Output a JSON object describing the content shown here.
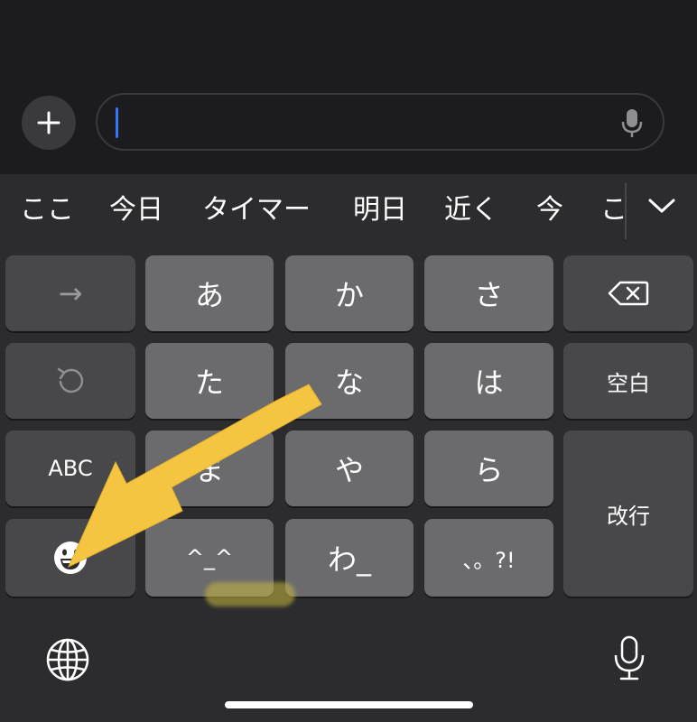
{
  "suggestions": [
    "ここ",
    "今日",
    "タイマー",
    "明日",
    "近く",
    "今",
    "こ"
  ],
  "keys": {
    "arrow_right": "→",
    "a": "あ",
    "ka": "か",
    "sa": "さ",
    "ta": "た",
    "na": "な",
    "ha": "は",
    "space": "空白",
    "abc": "ABC",
    "ma": "ま",
    "ya": "や",
    "ra": "ら",
    "return": "改行",
    "kaomoji": "^_^",
    "wa": "わ_",
    "punct": "、。?!"
  },
  "colors": {
    "annotation_arrow": "#f5c542",
    "caret": "#3478f6"
  },
  "icons": {
    "plus": "plus-icon",
    "mic": "microphone-icon",
    "chevron": "chevron-down-icon",
    "delete": "backspace-icon",
    "undo": "undo-icon",
    "emoji": "emoji-icon",
    "globe": "globe-icon"
  }
}
